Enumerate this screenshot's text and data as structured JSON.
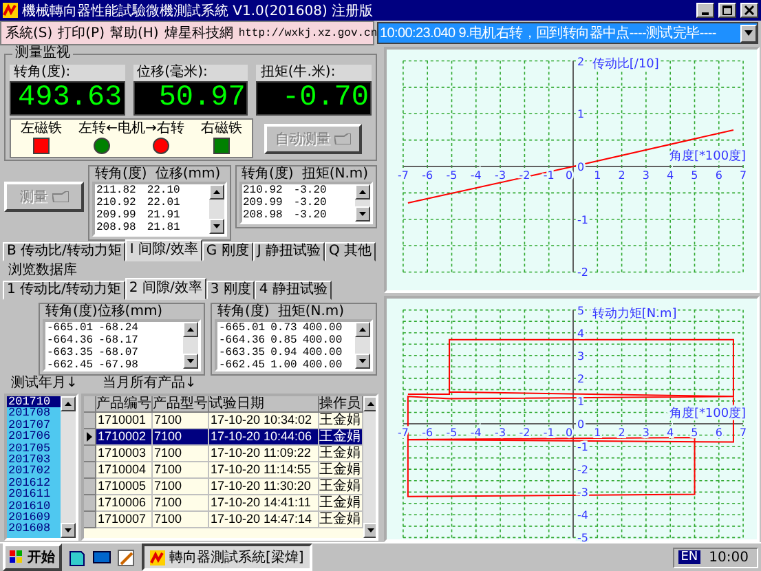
{
  "window": {
    "title": "機械轉向器性能試驗微機測試系統 V1.0(201608) 注册版"
  },
  "menu": {
    "items": [
      "系統(S)",
      "打印(P)",
      "幫助(H)",
      "煒星科技網"
    ],
    "link": "http://wxkj.xz.gov.cn"
  },
  "status_combo": {
    "value": "10:00:23.040 9.电机右转，回到转向器中点----测试完毕----"
  },
  "monitor": {
    "title": "测量监视",
    "readouts": [
      {
        "label": "转角(度):",
        "value": "493.63"
      },
      {
        "label": "位移(毫米):",
        "value": "50.97"
      },
      {
        "label": "扭矩(牛.米):",
        "value": "-0.70"
      }
    ],
    "indicator_labels": [
      "左磁铁",
      "左转←电机→右转",
      "右磁铁"
    ],
    "lights": [
      {
        "kind": "square",
        "color": "#ff0000"
      },
      {
        "kind": "circle",
        "color": "#008000"
      },
      {
        "kind": "circle",
        "color": "#ff0000"
      },
      {
        "kind": "square",
        "color": "#008000"
      }
    ],
    "auto_button": {
      "label": "自动测量",
      "disabled": true
    }
  },
  "measure": {
    "button": {
      "label": "测量",
      "disabled": true
    },
    "lists": [
      {
        "header": [
          "转角(度)",
          "位移(mm)"
        ],
        "rows": [
          [
            "211.82",
            "22.10"
          ],
          [
            "210.92",
            "22.01"
          ],
          [
            "209.99",
            "21.91"
          ],
          [
            "208.98",
            "21.81"
          ]
        ]
      },
      {
        "header": [
          "转角(度)",
          "扭矩(N.m)"
        ],
        "rows": [
          [
            "210.92",
            "-3.20"
          ],
          [
            "209.99",
            "-3.20"
          ],
          [
            "208.98",
            "-3.20"
          ]
        ]
      }
    ]
  },
  "tabs": [
    {
      "label": "B 传动比/转动力矩",
      "selected": false
    },
    {
      "label": "I 间隙/效率",
      "selected": true
    },
    {
      "label": "G 刚度",
      "selected": false
    },
    {
      "label": "J 静扭试验",
      "selected": false
    },
    {
      "label": "Q 其他",
      "selected": false
    }
  ],
  "database": {
    "title": "浏览数据库",
    "tabs": [
      {
        "label": "1 传动比/转动力矩",
        "selected": false
      },
      {
        "label": "2 间隙/效率",
        "selected": true
      },
      {
        "label": "3 刚度",
        "selected": false
      },
      {
        "label": "4 静扭试验",
        "selected": false
      }
    ],
    "lists": [
      {
        "header": [
          "转角(度)位移(mm)"
        ],
        "rows": [
          [
            "-665.01",
            "-68.24"
          ],
          [
            "-664.36",
            "-68.17"
          ],
          [
            "-663.35",
            "-68.07"
          ],
          [
            "-662.45",
            "-67.98"
          ]
        ]
      },
      {
        "header": [
          "转角(度)",
          "扭矩(N.m)"
        ],
        "rows": [
          [
            "-665.01",
            "0.73",
            "400.00"
          ],
          [
            "-664.36",
            "0.85",
            "400.00"
          ],
          [
            "-663.35",
            "0.94",
            "400.00"
          ],
          [
            "-662.45",
            "1.00",
            "400.00"
          ]
        ]
      }
    ],
    "month_heading": "测试年月↓",
    "products_heading": "当月所有产品↓",
    "months": [
      {
        "label": "201710",
        "selected": true
      },
      {
        "label": "201708",
        "selected": false
      },
      {
        "label": "201707",
        "selected": false
      },
      {
        "label": "201706",
        "selected": false
      },
      {
        "label": "201705",
        "selected": false
      },
      {
        "label": "201703",
        "selected": false
      },
      {
        "label": "201702",
        "selected": false
      },
      {
        "label": "201612",
        "selected": false
      },
      {
        "label": "201611",
        "selected": false
      },
      {
        "label": "201610",
        "selected": false
      },
      {
        "label": "201609",
        "selected": false
      },
      {
        "label": "201608",
        "selected": false
      }
    ],
    "table": {
      "columns": [
        "产品编号",
        "产品型号",
        "试验日期",
        "操作员"
      ],
      "rows": [
        {
          "cells": [
            "1710001",
            "7100",
            "17-10-20 10:34:02",
            "王金娟"
          ],
          "selected": false
        },
        {
          "cells": [
            "1710002",
            "7100",
            "17-10-20 10:44:06",
            "王金娟"
          ],
          "selected": true
        },
        {
          "cells": [
            "1710003",
            "7100",
            "17-10-20 11:09:22",
            "王金娟"
          ],
          "selected": false
        },
        {
          "cells": [
            "1710004",
            "7100",
            "17-10-20 11:14:55",
            "王金娟"
          ],
          "selected": false
        },
        {
          "cells": [
            "1710005",
            "7100",
            "17-10-20 11:30:20",
            "王金娟"
          ],
          "selected": false
        },
        {
          "cells": [
            "1710006",
            "7100",
            "17-10-20 14:41:11",
            "王金娟"
          ],
          "selected": false
        },
        {
          "cells": [
            "1710007",
            "7100",
            "17-10-20 14:47:14",
            "王金娟"
          ],
          "selected": false
        }
      ]
    }
  },
  "charts": [
    {
      "chart_data": {
        "type": "line",
        "ylabel": "传动比[/10]",
        "xlabel": "角度[*100度]",
        "x": [
          -6.8,
          0,
          6.6
        ],
        "series": [
          {
            "color": "#ff0000",
            "values": [
              -0.69,
              0,
              0.69
            ]
          }
        ],
        "grid": true,
        "xlim": [
          -7,
          7
        ],
        "ylim": [
          -2,
          2
        ],
        "xticks": [
          -7,
          -6,
          -5,
          -4,
          -3,
          -2,
          -1,
          0,
          1,
          2,
          3,
          4,
          5,
          6,
          7
        ],
        "yticks": [
          -2,
          -1,
          0,
          1,
          2
        ]
      }
    },
    {
      "chart_data": {
        "type": "line",
        "ylabel": "转动力矩[N.m]",
        "xlabel": "角度[*100度]",
        "x": [
          -6.8,
          -5.1,
          -5.1,
          6.6,
          6.6,
          -5.1,
          -6.8,
          -6.8,
          5.0,
          5.0,
          -6.8,
          -6.8,
          6.6,
          6.6,
          -5.1
        ],
        "series": [
          {
            "color": "#ff0000",
            "values": [
              1.3,
              1.3,
              3.7,
              3.7,
              1.2,
              1.1,
              1.2,
              -0.7,
              -0.6,
              -3.1,
              -3.2,
              -0.7,
              -0.8,
              1.2,
              1.4
            ]
          }
        ],
        "grid": true,
        "xlim": [
          -7,
          7
        ],
        "ylim": [
          -5,
          5
        ],
        "xticks": [
          -7,
          -6,
          -5,
          -4,
          -3,
          -2,
          -1,
          0,
          1,
          2,
          3,
          4,
          5,
          6,
          7
        ],
        "yticks": [
          -5,
          -4,
          -3,
          -2,
          -1,
          0,
          1,
          2,
          3,
          4,
          5
        ]
      }
    }
  ],
  "taskbar": {
    "start": "开始",
    "task": "轉向器測試系統[梁煒]",
    "language": "EN",
    "clock": "10:00"
  }
}
